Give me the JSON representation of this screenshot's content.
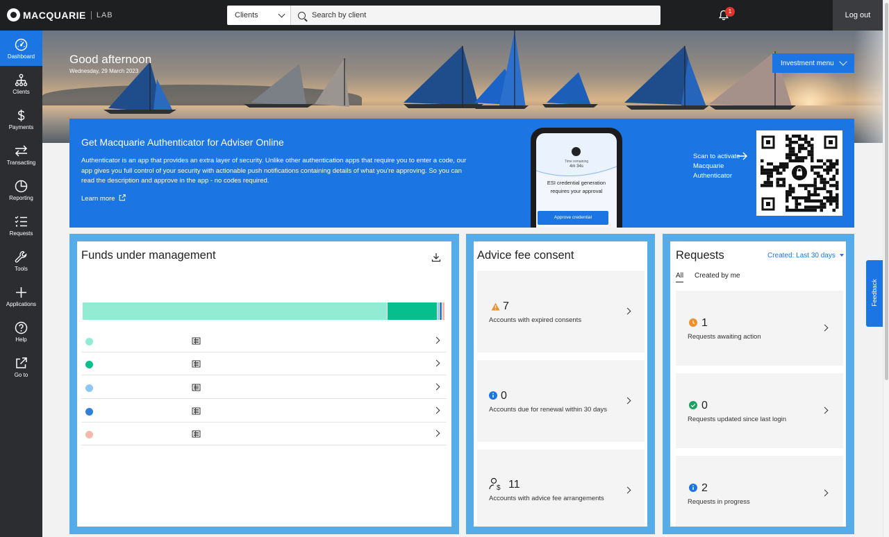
{
  "header": {
    "logo_text": "MACQUARIE",
    "logo_lab": "LAB",
    "search_type": "Clients",
    "search_placeholder": "Search by client",
    "notification_count": "1",
    "logout_label": "Log out"
  },
  "sidebar": {
    "items": [
      {
        "label": "Dashboard",
        "icon": "dashboard-icon",
        "active": true
      },
      {
        "label": "Clients",
        "icon": "clients-icon"
      },
      {
        "label": "Payments",
        "icon": "dollar-icon"
      },
      {
        "label": "Transacting",
        "icon": "transfer-icon"
      },
      {
        "label": "Reporting",
        "icon": "pie-chart-icon"
      },
      {
        "label": "Requests",
        "icon": "checklist-icon"
      },
      {
        "label": "Tools",
        "icon": "wrench-icon"
      },
      {
        "label": "Applications",
        "icon": "plus-icon"
      },
      {
        "label": "Help",
        "icon": "help-icon"
      },
      {
        "label": "Go to",
        "icon": "external-link-icon"
      }
    ]
  },
  "hero": {
    "greeting": "Good afternoon",
    "date": "Wednesday, 29 March 2023",
    "investment_menu_label": "Investment menu"
  },
  "banner": {
    "title": "Get Macquarie Authenticator for Adviser Online",
    "body": "Authenticator is an app that provides an extra layer of security. Unlike other authentication apps that require you to enter a code, our app gives you full control of your security with actionable push notifications containing details of what you're approving. So you can read the description and approve in the app - no codes required.",
    "learn_more": "Learn more",
    "phone_time_label": "Time remaining",
    "phone_time": "4m 34s",
    "phone_message": "ESI credential generation requires your approval",
    "phone_button": "Approve credential",
    "scan_text": "Scan to activate Macquarie Authenticator"
  },
  "funds": {
    "title": "Funds under management",
    "bar_segments": [
      {
        "color": "#92ecd3",
        "share": 0.838
      },
      {
        "color": "#06bf8c",
        "share": 0.138
      },
      {
        "color": "#8fc6f5",
        "share": 0.006
      },
      {
        "color": "#2f80d8",
        "share": 0.008
      },
      {
        "color": "#f5b8ab",
        "share": 0.008
      }
    ],
    "rows": [
      {
        "color": "#92ecd3"
      },
      {
        "color": "#06bf8c"
      },
      {
        "color": "#8fc6f5"
      },
      {
        "color": "#2f80d8"
      },
      {
        "color": "#f5b8ab"
      }
    ]
  },
  "advice": {
    "title": "Advice fee consent",
    "tiles": [
      {
        "count": "7",
        "label": "Accounts with expired consents",
        "icon": "warning-icon"
      },
      {
        "count": "0",
        "label": "Accounts due for renewal within 30 days",
        "icon": "info-icon"
      },
      {
        "count": "11",
        "label": "Accounts with advice fee arrangements",
        "icon": "person-dollar-icon"
      }
    ]
  },
  "requests": {
    "title": "Requests",
    "filter": "Created: Last 30 days",
    "tab_all": "All",
    "tab_mine": "Created by me",
    "tiles": [
      {
        "count": "1",
        "label": "Requests awaiting action",
        "icon": "clock-icon"
      },
      {
        "count": "0",
        "label": "Requests updated since last login",
        "icon": "check-circle-icon"
      },
      {
        "count": "2",
        "label": "Requests in progress",
        "icon": "info-icon"
      }
    ]
  },
  "feedback_label": "Feedback",
  "colors": {
    "brand_blue": "#1b76e3",
    "card_frame": "#56abe9",
    "sidebar_bg": "#2b2d30",
    "topbar_bg": "#1d1f21"
  }
}
